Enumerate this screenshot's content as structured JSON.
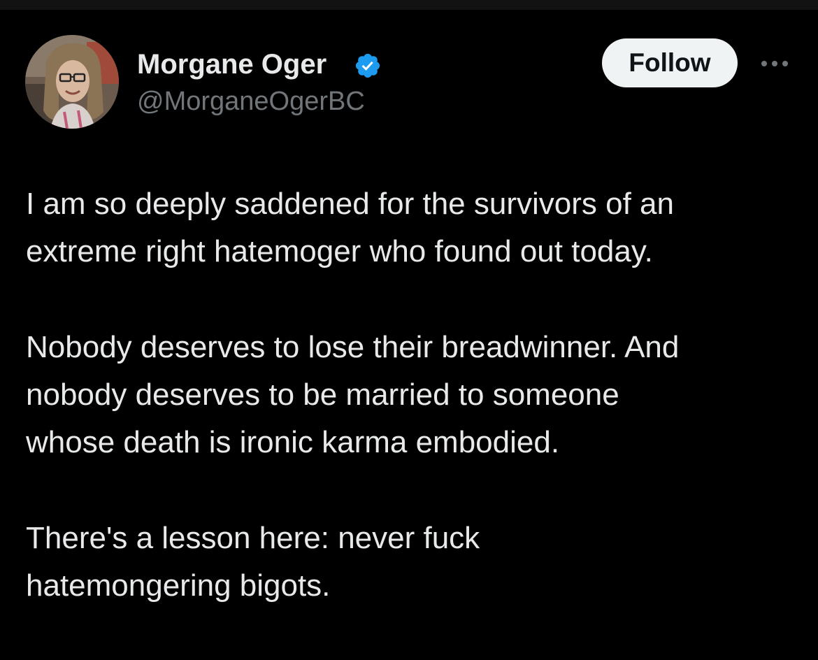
{
  "author": {
    "display_name": "Morgane Oger",
    "handle": "@MorganeOgerBC",
    "verified": true,
    "avatar_icon": "profile-photo"
  },
  "actions": {
    "follow_label": "Follow",
    "more_icon": "more-horizontal-icon"
  },
  "tweet": {
    "paragraphs": [
      {
        "lines": [
          "I am so deeply saddened for the survivors of an",
          "extreme right hatemoger who found out today."
        ]
      },
      {
        "lines": [
          "Nobody deserves to lose their breadwinner. And",
          "nobody deserves to be married to someone",
          "whose death is ironic karma embodied."
        ]
      },
      {
        "lines": [
          "There's a lesson here: never fuck",
          "hatemongering bigots."
        ]
      }
    ]
  },
  "colors": {
    "background": "#000000",
    "text_primary": "#e7e9ea",
    "text_secondary": "#71767b",
    "verified_badge": "#1d9bf0",
    "follow_button_bg": "#eff3f4"
  }
}
